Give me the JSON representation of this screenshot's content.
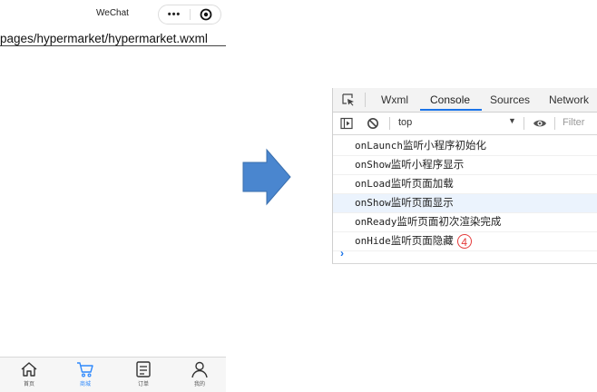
{
  "simulator": {
    "nav_title": "WeChat",
    "capsule_more": "•••",
    "path": "pages/hypermarket/hypermarket.wxml",
    "tabs": [
      {
        "label": "首页",
        "icon": "home-icon",
        "active": false
      },
      {
        "label": "商城",
        "icon": "cart-icon",
        "active": true
      },
      {
        "label": "订单",
        "icon": "order-icon",
        "active": false
      },
      {
        "label": "我的",
        "icon": "user-icon",
        "active": false
      }
    ]
  },
  "devtools": {
    "tabs": [
      "Wxml",
      "Console",
      "Sources",
      "Network"
    ],
    "active_tab": "Console",
    "context": "top",
    "filter_placeholder": "Filter",
    "logs": [
      {
        "fn": "onLaunch",
        "text": "监听小程序初始化",
        "highlight": false
      },
      {
        "fn": "onShow",
        "text": "监听小程序显示",
        "highlight": false
      },
      {
        "fn": "onLoad",
        "text": "监听页面加载",
        "highlight": false
      },
      {
        "fn": "onShow",
        "text": "监听页面显示",
        "highlight": true
      },
      {
        "fn": "onReady",
        "text": "监听页面初次渲染完成",
        "highlight": false
      },
      {
        "fn": "onHide",
        "text": "监听页面隐藏",
        "highlight": false
      }
    ],
    "step_badge": "4",
    "prompt": "›"
  },
  "colors": {
    "accent": "#1a73e8",
    "arrow": "#4a86cf",
    "tab_active": "#2f89fc",
    "badge": "#e43b3b"
  }
}
